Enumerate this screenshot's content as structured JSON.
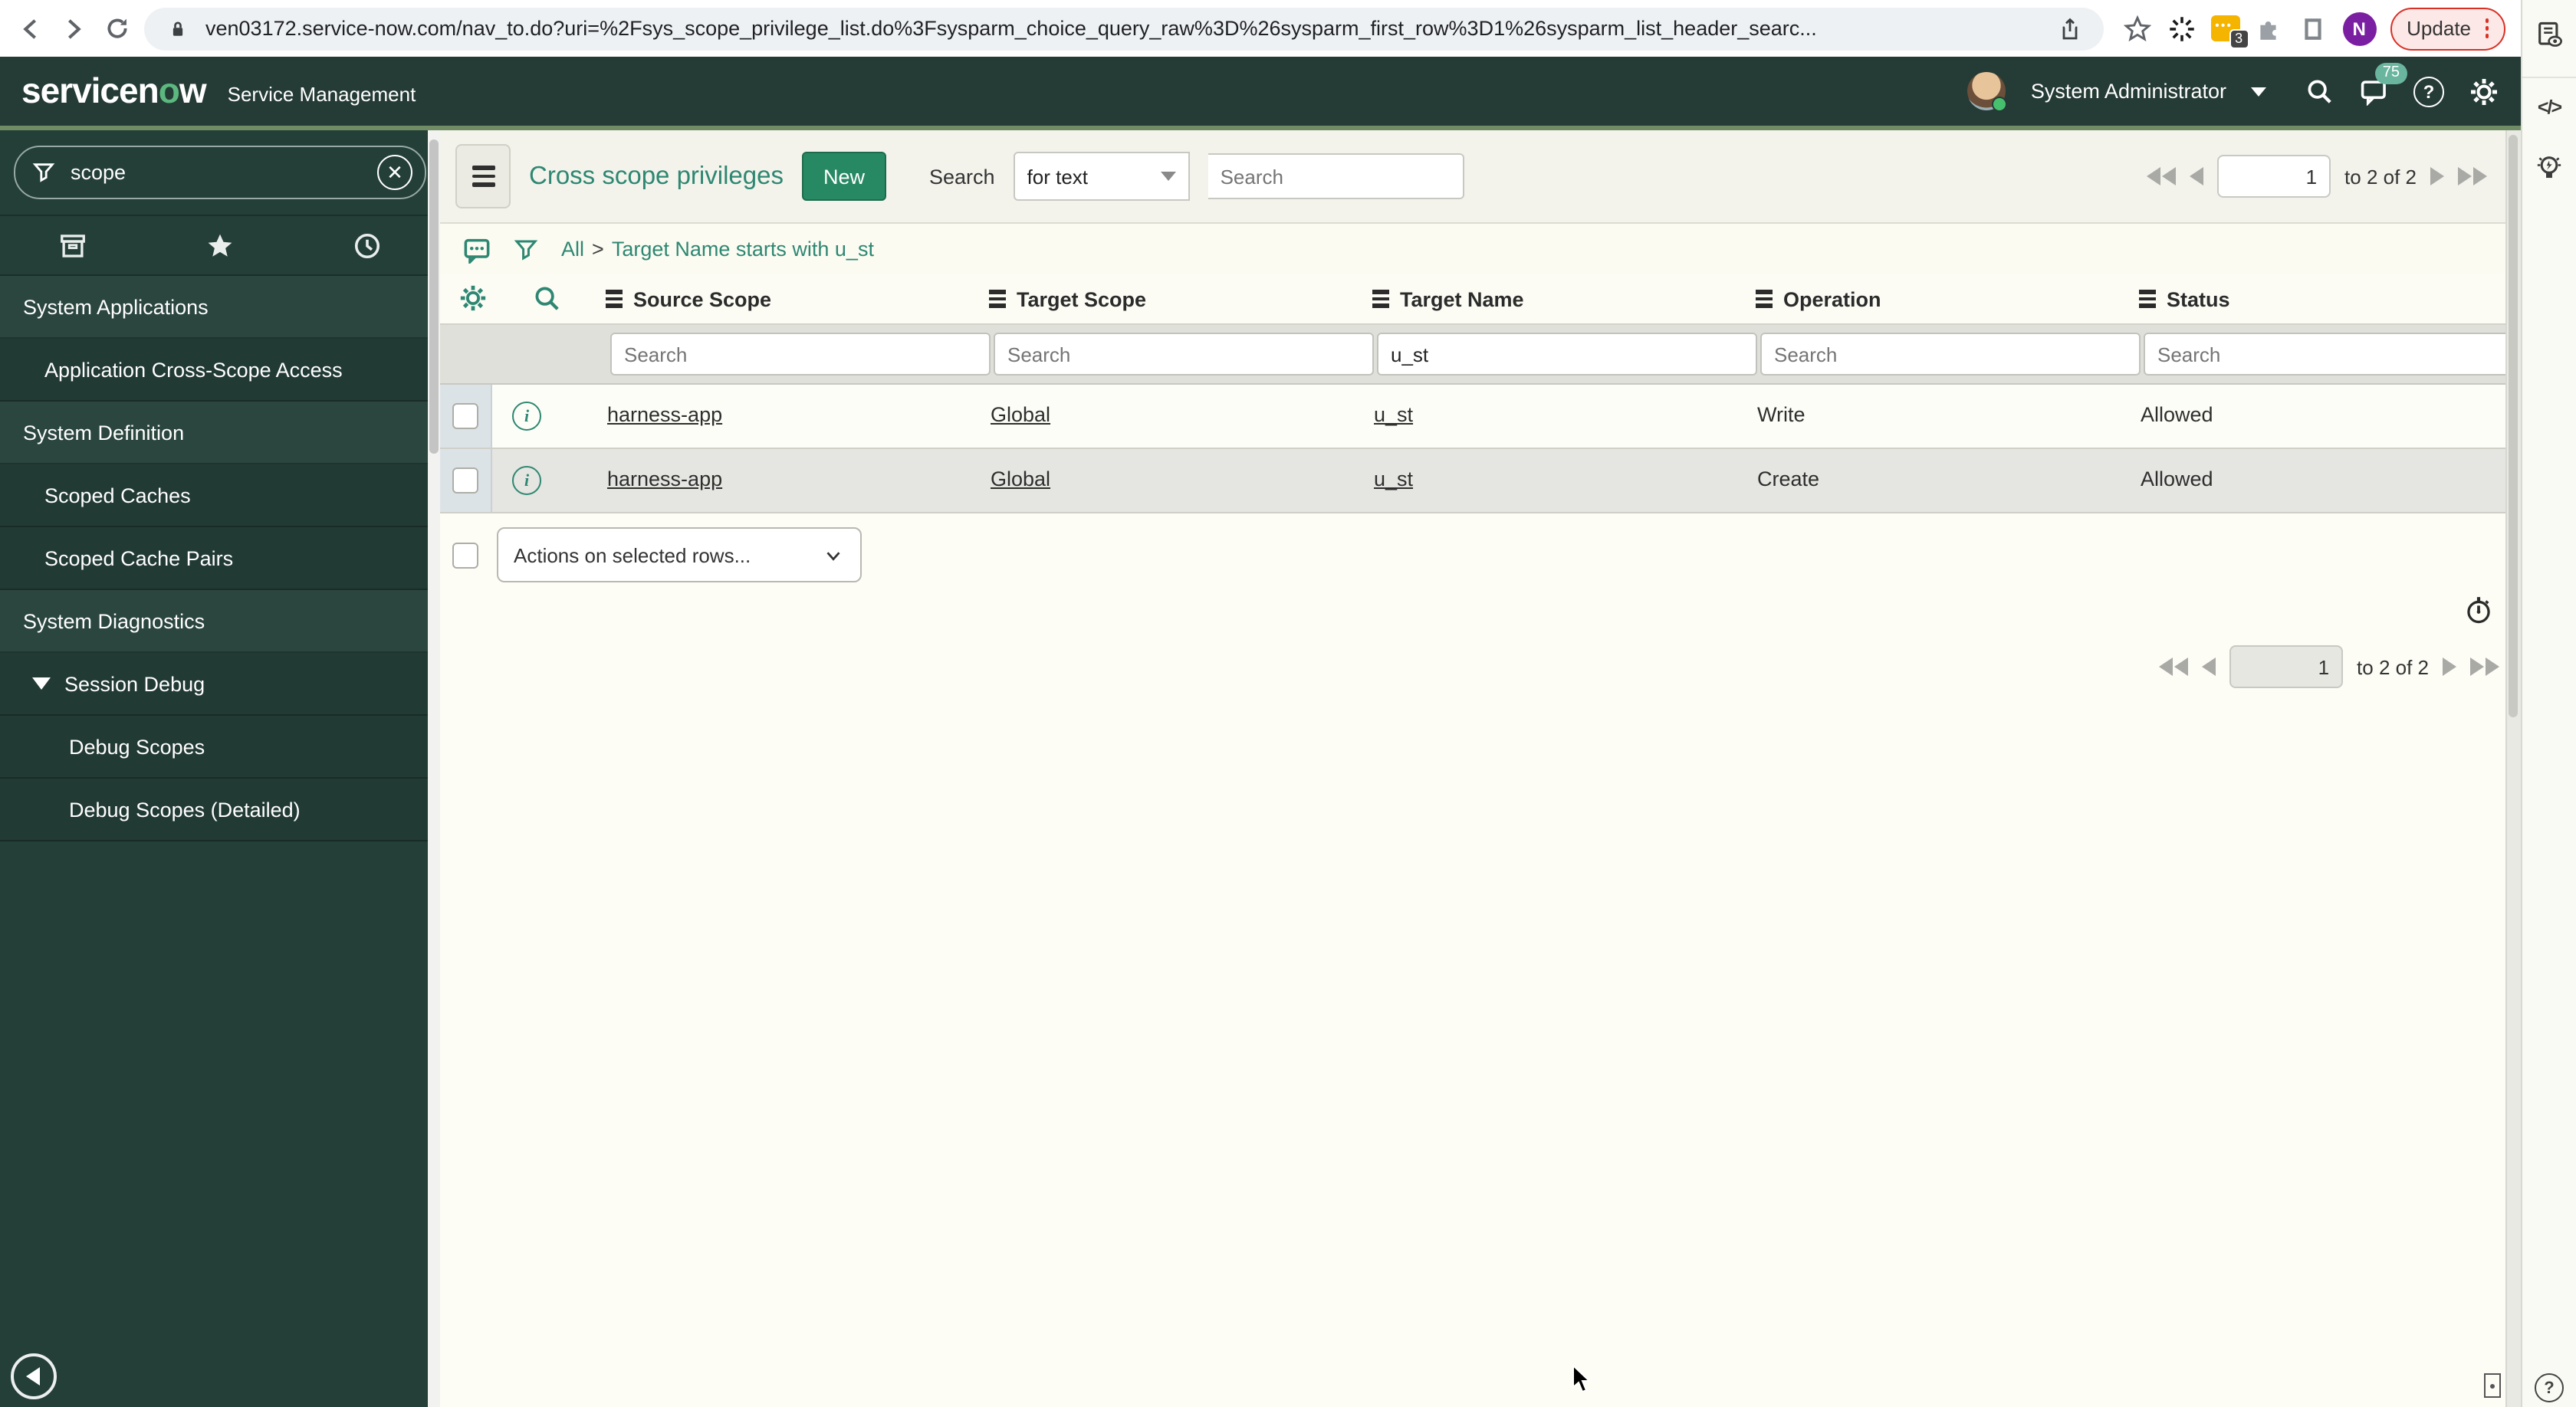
{
  "browser": {
    "url": "ven03172.service-now.com/nav_to.do?uri=%2Fsys_scope_privilege_list.do%3Fsysparm_choice_query_raw%3D%26sysparm_first_row%3D1%26sysparm_list_header_searc...",
    "profile_initial": "N",
    "update_label": "Update",
    "extension_badge": "3"
  },
  "header": {
    "logo": {
      "part1": "servicen",
      "part2": "o",
      "part3": "w"
    },
    "product_name": "Service Management",
    "user_name": "System Administrator",
    "notification_count": "75"
  },
  "sidebar": {
    "filter_value": "scope",
    "items": [
      {
        "label": "System Applications",
        "type": "section"
      },
      {
        "label": "Application Cross-Scope Access",
        "type": "item"
      },
      {
        "label": "System Definition",
        "type": "section"
      },
      {
        "label": "Scoped Caches",
        "type": "item"
      },
      {
        "label": "Scoped Cache Pairs",
        "type": "item"
      },
      {
        "label": "System Diagnostics",
        "type": "section"
      },
      {
        "label": "Session Debug",
        "type": "expanded"
      },
      {
        "label": "Debug Scopes",
        "type": "subitem"
      },
      {
        "label": "Debug Scopes (Detailed)",
        "type": "subitem"
      }
    ]
  },
  "list": {
    "title": "Cross scope privileges",
    "new_button": "New",
    "search_label": "Search",
    "search_type": "for text",
    "search_placeholder": "Search",
    "breadcrumb": {
      "root": "All",
      "separator": ">",
      "filter": "Target Name starts with u_st"
    },
    "pagination": {
      "page": "1",
      "range_text": "to 2 of 2"
    },
    "columns": [
      "Source Scope",
      "Target Scope",
      "Target Name",
      "Operation",
      "Status"
    ],
    "filter_row": {
      "placeholder": "Search",
      "target_name_value": "u_st"
    },
    "rows": [
      {
        "source_scope": "harness-app",
        "target_scope": "Global",
        "target_name": "u_st",
        "operation": "Write",
        "status": "Allowed"
      },
      {
        "source_scope": "harness-app",
        "target_scope": "Global",
        "target_name": "u_st",
        "operation": "Create",
        "status": "Allowed"
      }
    ],
    "actions_select": "Actions on selected rows..."
  },
  "right_panel": {
    "code_glyph": "</>"
  },
  "colors": {
    "header_bg": "#253b35",
    "accent_teal": "#2e8772",
    "new_button_bg": "#278964",
    "update_red": "#d93025",
    "badge_green": "#69b59e",
    "profile_purple": "#7b1fa2"
  }
}
